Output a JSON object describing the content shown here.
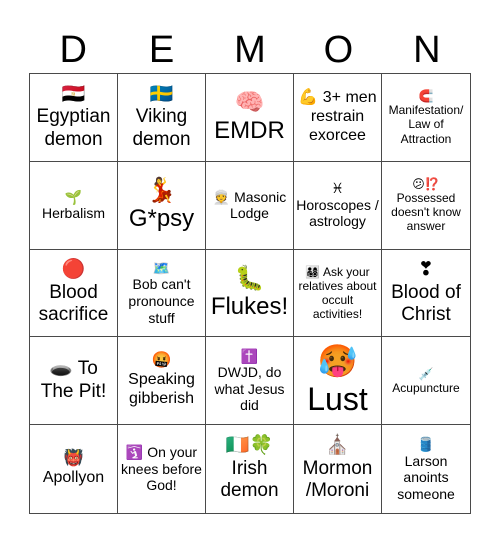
{
  "title_letters": [
    "D",
    "E",
    "M",
    "O",
    "N"
  ],
  "cells": [
    {
      "emoji": "🇪🇬",
      "text": "Egyptian demon",
      "icon": "egypt-flag-icon",
      "size": "m"
    },
    {
      "emoji": "🇸🇪",
      "text": "Viking demon",
      "icon": "sweden-flag-icon",
      "size": "m"
    },
    {
      "emoji": "🧠",
      "text": "EMDR",
      "icon": "brain-icon",
      "size": "l"
    },
    {
      "emoji": "💪",
      "text": "3+ men restrain exorcee",
      "icon": "flexed-biceps-icon",
      "size": "ms",
      "inline": true
    },
    {
      "emoji": "🧲",
      "text": "Manifestation/ Law of Attraction",
      "icon": "magnet-icon",
      "size": "xs"
    },
    {
      "emoji": "🌱",
      "text": "Herbalism",
      "icon": "seedling-icon",
      "size": "s"
    },
    {
      "emoji": "💃",
      "text": "G*psy",
      "icon": "dancer-icon",
      "size": "l"
    },
    {
      "emoji": "👳",
      "text": "Masonic Lodge",
      "icon": "person-turban-icon",
      "size": "s",
      "inline": true
    },
    {
      "emoji": "♓",
      "text": "Horoscopes / astrology",
      "icon": "pisces-icon",
      "size": "s"
    },
    {
      "emoji": "😕⁉️",
      "text": "Possessed doesn't know answer",
      "icon": "confused-face-icon",
      "size": "xs"
    },
    {
      "emoji": "🔴",
      "text": "Blood sacrifice",
      "icon": "red-circle-icon",
      "size": "m"
    },
    {
      "emoji": "🗺️",
      "text": "Bob can't pronounce stuff",
      "icon": "world-map-icon",
      "size": "s"
    },
    {
      "emoji": "🐛",
      "text": "Flukes!",
      "icon": "caterpillar-icon",
      "size": "l"
    },
    {
      "emoji": "👨‍👩‍👧‍👦",
      "text": "Ask your relatives about occult activities!",
      "icon": "family-icon",
      "size": "xs",
      "inline": true
    },
    {
      "emoji": "❣",
      "text": "Blood of Christ",
      "icon": "heart-exclamation-icon",
      "size": "m"
    },
    {
      "emoji": "🕳️",
      "text": "To The Pit!",
      "icon": "hole-icon",
      "size": "m",
      "inline": true
    },
    {
      "emoji": "🤬",
      "text": "Speaking gibberish",
      "icon": "cursing-face-icon",
      "size": "ms"
    },
    {
      "emoji": "✝️",
      "text": "DWJD, do what Jesus did",
      "icon": "latin-cross-icon",
      "size": "s"
    },
    {
      "emoji": "🥵",
      "text": "Lust",
      "icon": "hot-face-icon",
      "size": "xl"
    },
    {
      "emoji": "💉",
      "text": "Acupuncture",
      "icon": "syringe-icon",
      "size": "xs"
    },
    {
      "emoji": "👹",
      "text": "Apollyon",
      "icon": "ogre-icon",
      "size": "ms"
    },
    {
      "emoji": "🛐",
      "text": "On your knees before God!",
      "icon": "place-of-worship-icon",
      "size": "s",
      "inline": true
    },
    {
      "emoji": "🇮🇪🍀",
      "text": "Irish demon",
      "icon": "ireland-flag-clover-icon",
      "size": "m"
    },
    {
      "emoji": "⛪",
      "text": "Mormon /Moroni",
      "icon": "church-icon",
      "size": "m"
    },
    {
      "emoji": "🛢️",
      "text": "Larson anoints someone",
      "icon": "oil-drum-icon",
      "size": "s"
    }
  ]
}
